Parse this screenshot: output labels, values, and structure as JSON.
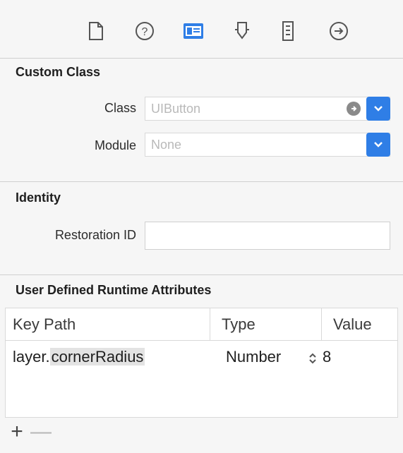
{
  "toolbar": {
    "icons": [
      "file-icon",
      "help-icon",
      "identity-inspector-icon",
      "attributes-icon",
      "size-inspector-icon",
      "connections-icon"
    ],
    "accent": "#2f7ee6"
  },
  "custom_class": {
    "title": "Custom Class",
    "class_label": "Class",
    "class_placeholder": "UIButton",
    "module_label": "Module",
    "module_placeholder": "None"
  },
  "identity": {
    "title": "Identity",
    "restoration_label": "Restoration ID",
    "restoration_value": ""
  },
  "runtime_attributes": {
    "title": "User Defined Runtime Attributes",
    "columns": [
      "Key Path",
      "Type",
      "Value"
    ],
    "rows": [
      {
        "key_path_prefix": "layer.",
        "key_path_selected": "cornerRadius",
        "type": "Number",
        "value": "8"
      }
    ]
  },
  "bottom": {
    "add": "+",
    "remove": "—"
  }
}
